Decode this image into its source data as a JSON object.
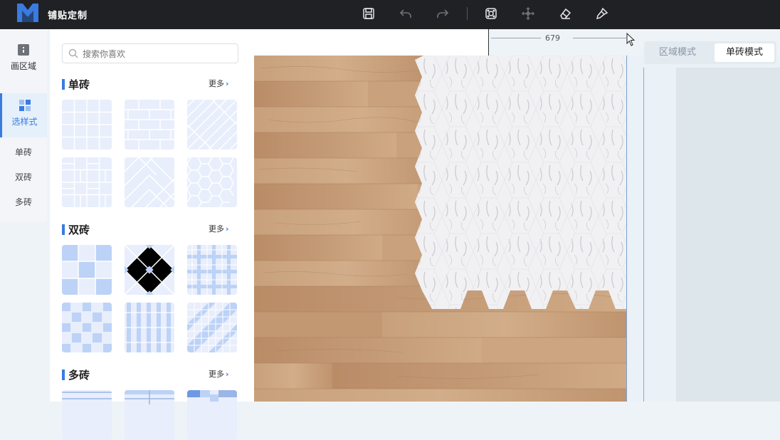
{
  "app": {
    "title": "铺贴定制"
  },
  "toolbar": {
    "buttons": [
      {
        "name": "save",
        "icon": "save-icon"
      },
      {
        "name": "undo",
        "icon": "undo-icon"
      },
      {
        "name": "redo",
        "icon": "redo-icon"
      },
      {
        "name": "frame",
        "icon": "frame-icon"
      },
      {
        "name": "move",
        "icon": "move-icon"
      },
      {
        "name": "eraser",
        "icon": "eraser-icon"
      },
      {
        "name": "brush",
        "icon": "brush-icon"
      }
    ]
  },
  "leftnav": {
    "draw_area": "画区域",
    "select_style": "选样式",
    "sub_items": [
      "单砖",
      "双砖",
      "多砖"
    ]
  },
  "panel": {
    "search_placeholder": "搜索你喜欢",
    "sections": [
      {
        "title": "单砖",
        "more": "更多"
      },
      {
        "title": "双砖",
        "more": "更多"
      },
      {
        "title": "多砖",
        "more": "更多"
      }
    ]
  },
  "canvas": {
    "ruler_value": "679"
  },
  "mode_switch": {
    "area_mode": "区域模式",
    "single_mode": "单砖模式",
    "active": "单砖模式"
  },
  "colors": {
    "topbar": "#1f2125",
    "accent": "#3a7be0",
    "wood": "#c89f7a",
    "marble": "#f2f2f4",
    "tile_light": "#e8eefb",
    "tile_blue": "#bcd2f7"
  }
}
